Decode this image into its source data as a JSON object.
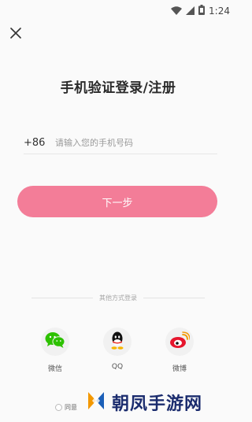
{
  "status_bar": {
    "time": "1:24",
    "icons": [
      "wifi-icon",
      "signal-icon",
      "battery-icon"
    ]
  },
  "header": {
    "close_icon": "close-icon",
    "title": "手机验证登录/注册"
  },
  "phone_form": {
    "country_code": "+86",
    "input_value": "",
    "placeholder": "请输入您的手机号码"
  },
  "next_button": {
    "label": "下一步",
    "color": "#f37d98"
  },
  "other_login": {
    "divider_text": "其他方式登录",
    "options": [
      {
        "label": "微信",
        "icon": "wechat-icon",
        "color": "#2dc100"
      },
      {
        "label": "QQ",
        "icon": "qq-icon",
        "color": "#111111"
      },
      {
        "label": "微博",
        "icon": "weibo-icon",
        "color": "#e6162d"
      }
    ]
  },
  "agreement": {
    "text": "同意"
  },
  "watermark": {
    "text": "朝凤手游网"
  }
}
